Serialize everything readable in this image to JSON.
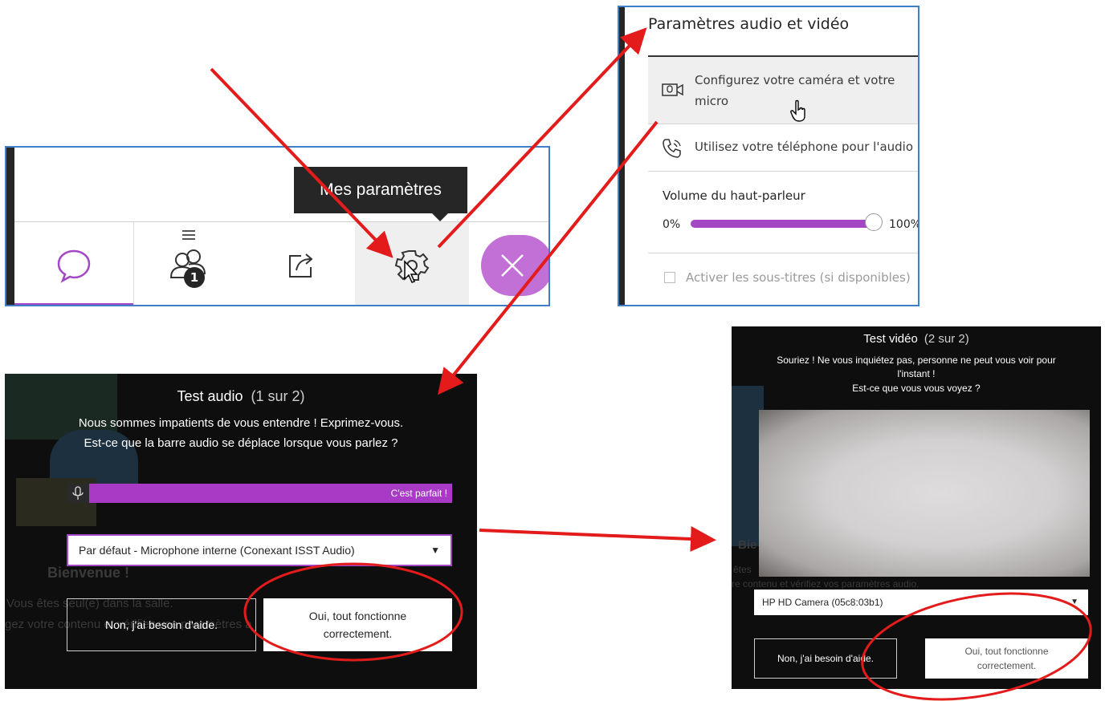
{
  "toolbar_panel": {
    "tooltip": "Mes paramètres",
    "participants_badge": "1",
    "tabs": [
      {
        "name": "chat",
        "icon": "chat-bubble-icon"
      },
      {
        "name": "participants",
        "icon": "participants-icon"
      },
      {
        "name": "share",
        "icon": "share-icon"
      },
      {
        "name": "settings",
        "icon": "gear-icon"
      },
      {
        "name": "close",
        "icon": "close-icon"
      }
    ],
    "accent_color": "#a347c4"
  },
  "settings_menu": {
    "title": "Paramètres audio et vidéo",
    "items": [
      {
        "label_line1": "Configurez votre caméra et votre",
        "label_line2": "micro",
        "icon": "camera-mic-icon"
      },
      {
        "label": "Utilisez votre téléphone pour l'audio",
        "icon": "phone-icon"
      }
    ],
    "volume": {
      "label": "Volume du haut-parleur",
      "min_label": "0%",
      "max_label": "100%",
      "level": 1.0
    },
    "subtitles": {
      "label": "Activer les sous-titres (si disponibles)",
      "checked": false
    }
  },
  "audio_test": {
    "title": "Test audio",
    "step": "(1 sur 2)",
    "message_line1": "Nous sommes impatients de vous entendre ! Exprimez-vous.",
    "message_line2": "Est-ce que la barre audio se déplace lorsque vous parlez ?",
    "level_label": "C'est parfait !",
    "microphone": "Par défaut - Microphone interne (Conexant ISST Audio)",
    "no_button": "Non, j'ai besoin d'aide.",
    "yes_button_line1": "Oui, tout fonctionne",
    "yes_button_line2": "correctement.",
    "background": {
      "welcome": "Bienvenue !",
      "alone_line": "Vous êtes seul(e) dans la salle.",
      "share_line": "gez votre contenu et vérifiez vos paramètres a"
    }
  },
  "video_test": {
    "title": "Test vidéo",
    "step": "(2 sur 2)",
    "message_line1": "Souriez ! Ne vous inquiétez pas, personne ne peut vous voir pour",
    "message_line2": "l'instant !",
    "message_line3": "Est-ce que vous vous voyez ?",
    "camera": "HP HD Camera (05c8:03b1)",
    "no_button": "Non, j'ai besoin d'aide.",
    "yes_button_line1": "Oui, tout fonctionne",
    "yes_button_line2": "correctement.",
    "background": {
      "welcome": "Bie",
      "line1": "êtes",
      "line2": "re contenu et vérifiez vos paramètres audio."
    }
  },
  "annotations": {
    "arrow_color": "#e31b1b"
  }
}
